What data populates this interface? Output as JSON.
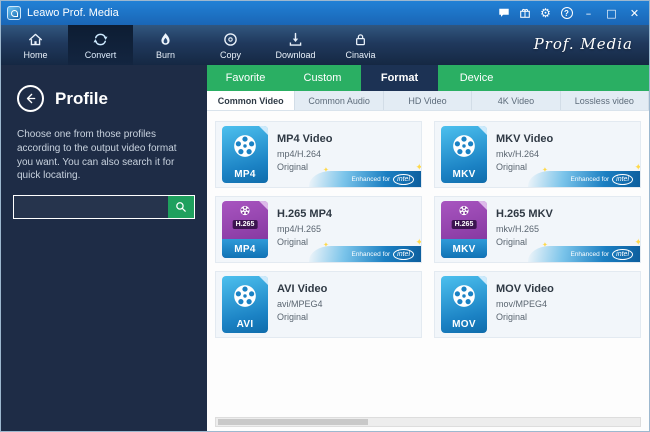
{
  "titlebar": {
    "title": "Leawo Prof. Media",
    "icons": {
      "gear": "⚙",
      "help": "?"
    },
    "controls": {
      "minimize": "–",
      "maximize": "□",
      "close": "✕"
    }
  },
  "toolbar": {
    "brand": "Prof. Media",
    "items": [
      {
        "label": "Home"
      },
      {
        "label": "Convert"
      },
      {
        "label": "Burn"
      },
      {
        "label": "Copy"
      },
      {
        "label": "Download"
      },
      {
        "label": "Cinavia"
      }
    ]
  },
  "sidebar": {
    "title": "Profile",
    "description": "Choose one from those profiles according to the output video format you want. You can also search it for quick locating.",
    "search": {
      "value": "",
      "placeholder": ""
    }
  },
  "tabs": {
    "main": [
      {
        "label": "Favorite"
      },
      {
        "label": "Custom"
      },
      {
        "label": "Format"
      },
      {
        "label": "Device"
      }
    ],
    "sub": [
      {
        "label": "Common Video"
      },
      {
        "label": "Common Audio"
      },
      {
        "label": "HD Video"
      },
      {
        "label": "4K Video"
      },
      {
        "label": "Lossless video"
      }
    ]
  },
  "intel_badge": {
    "prefix": "Enhanced for",
    "brand": "intel",
    "sparkle": "✦"
  },
  "profiles": [
    {
      "title": "MP4 Video",
      "format": "mp4/H.264",
      "quality": "Original",
      "icon_label": "MP4"
    },
    {
      "title": "MKV Video",
      "format": "mkv/H.264",
      "quality": "Original",
      "icon_label": "MKV"
    },
    {
      "title": "H.265 MP4",
      "format": "mp4/H.265",
      "quality": "Original",
      "icon_label": "MP4",
      "icon_top_label": "H.265"
    },
    {
      "title": "H.265 MKV",
      "format": "mkv/H.265",
      "quality": "Original",
      "icon_label": "MKV",
      "icon_top_label": "H.265"
    },
    {
      "title": "AVI Video",
      "format": "avi/MPEG4",
      "quality": "Original",
      "icon_label": "AVI"
    },
    {
      "title": "MOV Video",
      "format": "mov/MPEG4",
      "quality": "Original",
      "icon_label": "MOV"
    }
  ]
}
